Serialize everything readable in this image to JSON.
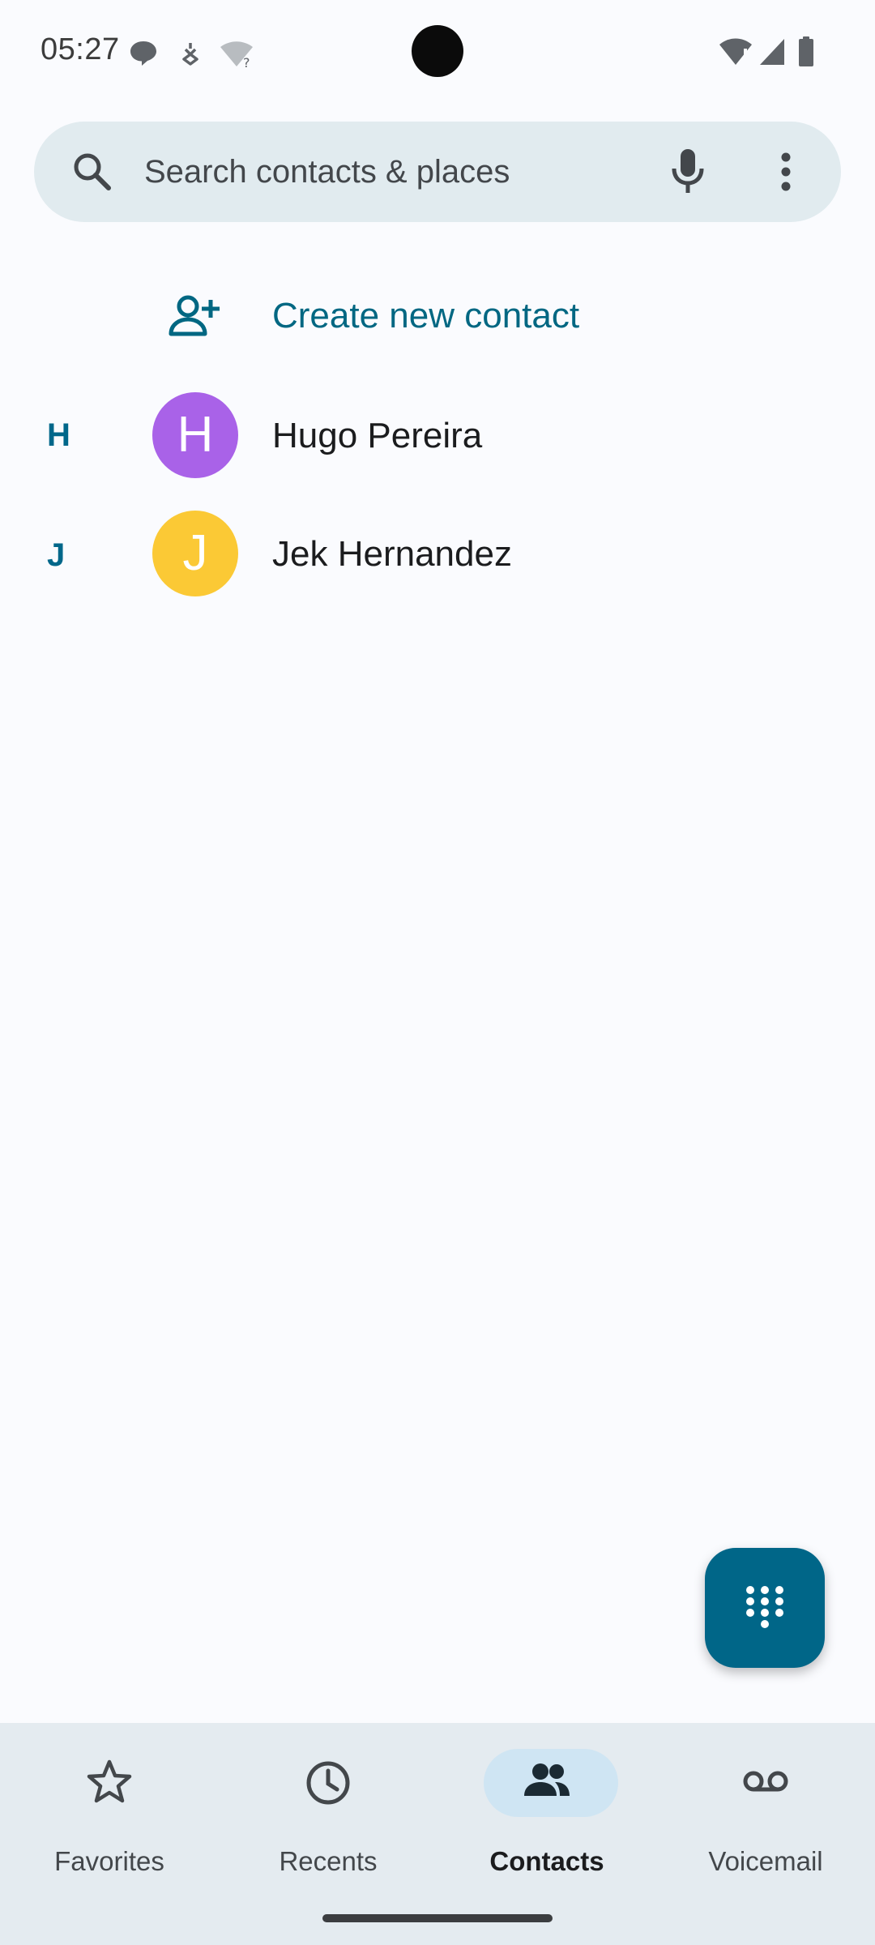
{
  "status_bar": {
    "time": "05:27",
    "left_icons": [
      "chat-bubble-icon",
      "vpn-key-icon",
      "wifi-question-icon"
    ],
    "right_icons": [
      "wifi-alert-icon",
      "cell-signal-icon",
      "battery-icon"
    ]
  },
  "search": {
    "placeholder": "Search contacts & places",
    "icons": [
      "search-icon",
      "mic-icon",
      "more-vert-icon"
    ]
  },
  "create_contact": {
    "label": "Create new contact",
    "icon": "person-add-icon"
  },
  "contacts": [
    {
      "section": "H",
      "initial": "H",
      "name": "Hugo Pereira",
      "avatar_color": "#a962e8"
    },
    {
      "section": "J",
      "initial": "J",
      "name": "Jek Hernandez",
      "avatar_color": "#fbc935"
    }
  ],
  "fab": {
    "icon": "dialpad-icon"
  },
  "bottom_nav": {
    "items": [
      {
        "label": "Favorites",
        "icon": "star-outline-icon",
        "active": false
      },
      {
        "label": "Recents",
        "icon": "clock-icon",
        "active": false
      },
      {
        "label": "Contacts",
        "icon": "people-icon",
        "active": true
      },
      {
        "label": "Voicemail",
        "icon": "voicemail-icon",
        "active": false
      }
    ]
  },
  "colors": {
    "accent": "#006782",
    "fab": "#006688",
    "search_bg": "#e1ebef",
    "nav_bg": "#e4ebf0",
    "nav_active_pill": "#cfe5f3"
  }
}
